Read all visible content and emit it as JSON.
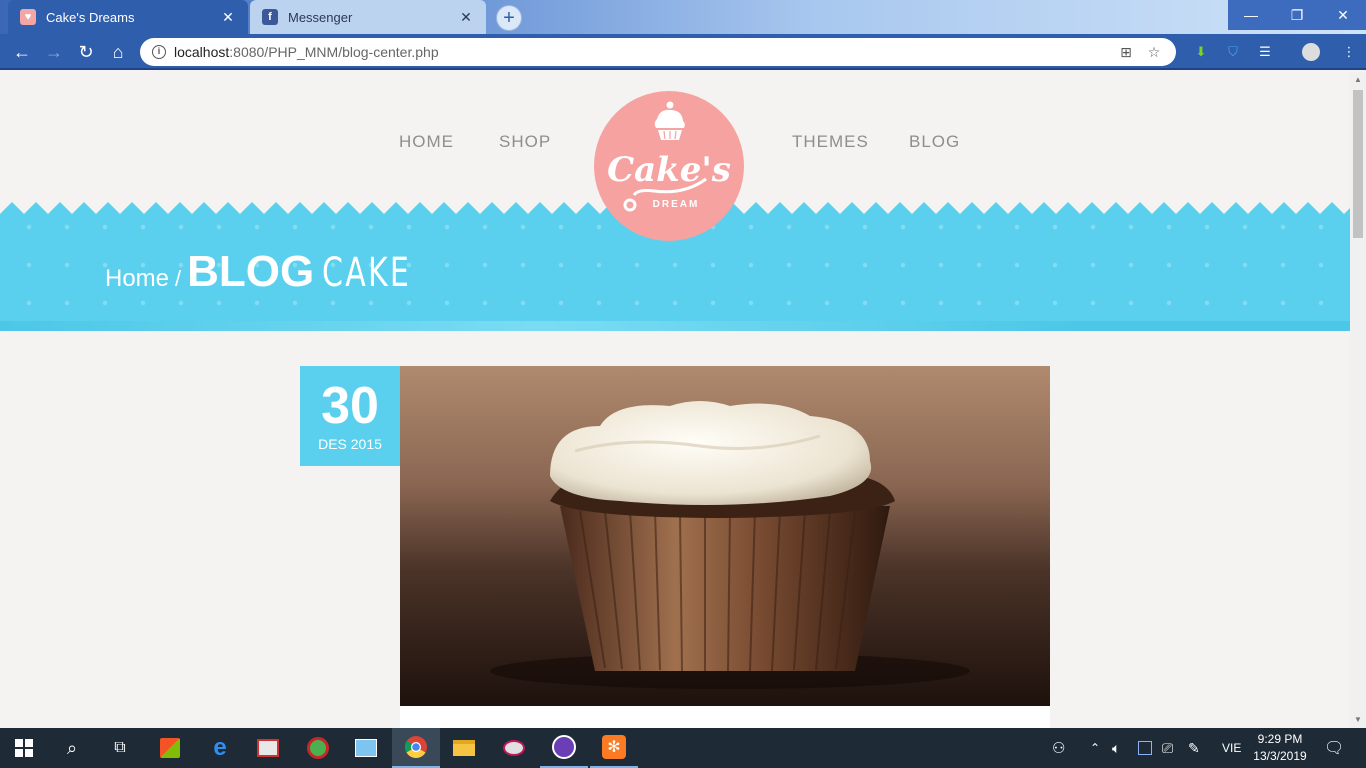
{
  "browser": {
    "tabs": [
      {
        "title": "Cake's Dreams",
        "favicon": "cupcake-favicon",
        "active": true
      },
      {
        "title": "Messenger",
        "favicon": "facebook-favicon",
        "active": false
      }
    ],
    "new_tab_label": "+",
    "address": {
      "host": "localhost",
      "path": ":8080/PHP_MNM/blog-center.php"
    },
    "window_controls": {
      "minimize": "—",
      "maximize": "❐",
      "close": "✕"
    }
  },
  "site": {
    "nav": {
      "home": "HOME",
      "shop": "SHOP",
      "themes": "THEMES",
      "blog": "BLOG"
    },
    "logo": {
      "script_text": "Cake's",
      "sub_text": "DREAM"
    },
    "breadcrumb": {
      "home": "Home",
      "separator": "/",
      "title_bold": "BLOG",
      "title_light": "CAKE"
    },
    "colors": {
      "accent_blue": "#5ad0ee",
      "logo_pink": "#f6a2a0",
      "page_bg": "#f4f3f1",
      "nav_text": "#8e8e8e"
    }
  },
  "post": {
    "day": "30",
    "month_year": "DES 2015",
    "image_subject": "cupcake-with-cream-frosting"
  },
  "taskbar": {
    "language": "VIE",
    "time": "9:29 PM",
    "date": "13/3/2019"
  }
}
